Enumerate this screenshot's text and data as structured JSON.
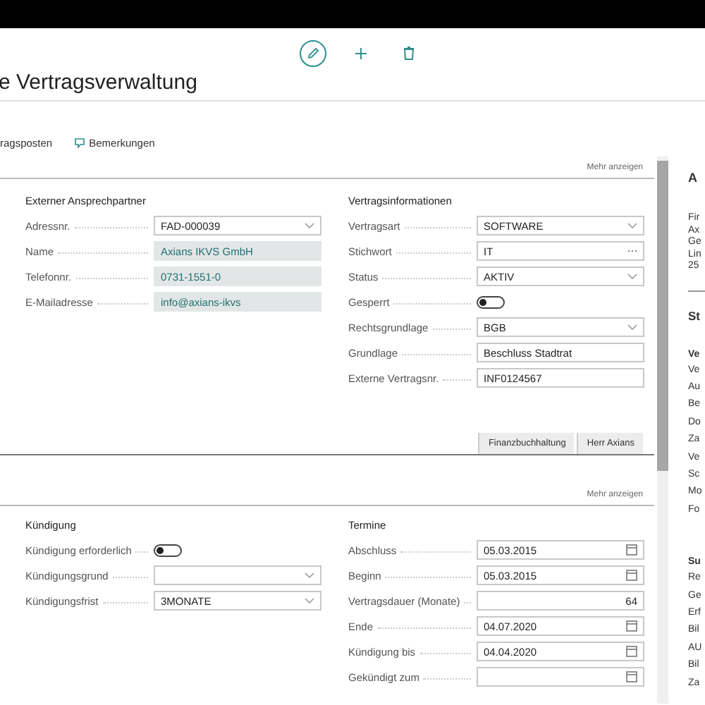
{
  "page": {
    "title": "e Vertragsverwaltung"
  },
  "actions": [
    {
      "kind": "plain",
      "label": "ragsposten"
    },
    {
      "kind": "comment",
      "label": "Bemerkungen"
    }
  ],
  "sections": [
    {
      "more": "Mehr anzeigen",
      "buttons": [
        "Finanzbuchhaltung",
        "Herr Axians"
      ],
      "groups": [
        {
          "title": "Externer Ansprechpartner",
          "fields": [
            {
              "label": "Adressnr.",
              "kind": "dropdown",
              "value": "FAD-000039"
            },
            {
              "label": "Name",
              "kind": "readonly",
              "value": "Axians IKVS GmbH"
            },
            {
              "label": "Telefonnr.",
              "kind": "readonly",
              "value": "0731-1551-0"
            },
            {
              "label": "E-Mailadresse",
              "kind": "readonly",
              "value": "info@axians-ikvs"
            }
          ]
        },
        {
          "title": "Vertragsinformationen",
          "fields": [
            {
              "label": "Vertragsart",
              "kind": "dropdown",
              "value": "SOFTWARE"
            },
            {
              "label": "Stichwort",
              "kind": "lookup",
              "value": "IT"
            },
            {
              "label": "Status",
              "kind": "dropdown",
              "value": "AKTIV"
            },
            {
              "label": "Gesperrt",
              "kind": "toggle",
              "on": false
            },
            {
              "label": "Rechtsgrundlage",
              "kind": "dropdown",
              "value": "BGB"
            },
            {
              "label": "Grundlage",
              "kind": "text",
              "value": "Beschluss Stadtrat"
            },
            {
              "label": "Externe Vertragsnr.",
              "kind": "text",
              "value": "INF0124567"
            }
          ]
        }
      ]
    },
    {
      "more": "Mehr anzeigen",
      "groups": [
        {
          "title": "Kündigung",
          "fields": [
            {
              "label": "Kündigung erforderlich",
              "kind": "toggle",
              "on": false
            },
            {
              "label": "Kündigungsgrund",
              "kind": "dropdown"
            },
            {
              "label": "Kündigungsfrist",
              "kind": "dropdown",
              "value": "3MONATE"
            }
          ]
        },
        {
          "title": "Termine",
          "fields": [
            {
              "label": "Abschluss",
              "kind": "date",
              "value": "05.03.2015"
            },
            {
              "label": "Beginn",
              "kind": "date",
              "value": "05.03.2015"
            },
            {
              "label": "Vertragsdauer (Monate)",
              "kind": "number",
              "value": "64"
            },
            {
              "label": "Ende",
              "kind": "date",
              "value": "04.07.2020"
            },
            {
              "label": "Kündigung bis",
              "kind": "date",
              "value": "04.04.2020"
            },
            {
              "label": "Gekündigt zum",
              "kind": "date"
            }
          ]
        }
      ]
    }
  ],
  "factbox": {
    "title": "A",
    "lines": [
      "Fir",
      "Ax",
      "Ge",
      "Lin",
      "25"
    ],
    "heading": "St",
    "groups": [
      {
        "title": "Ve",
        "items": [
          "Ve",
          "Au",
          "Be",
          "Do",
          "Za",
          "Ve",
          "Sc",
          "Mo",
          "Fo"
        ]
      },
      {
        "title": "Su",
        "items": [
          "Re",
          "Ge",
          "Erf",
          "Bil",
          "AU",
          "Bil",
          "Za"
        ]
      }
    ]
  }
}
